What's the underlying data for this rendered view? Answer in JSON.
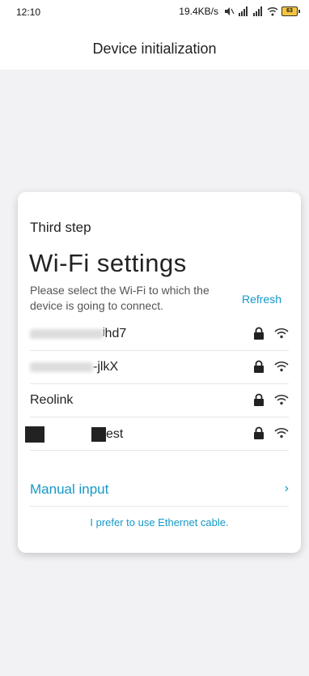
{
  "status_bar": {
    "time": "12:10",
    "speed": "19.4KB/s",
    "battery": "63"
  },
  "header": {
    "title": "Device initialization"
  },
  "card": {
    "step": "Third step",
    "heading": "Wi-Fi settings",
    "description": "Please select the Wi-Fi to which the device is going to connect.",
    "refresh_label": "Refresh",
    "networks": [
      {
        "name_visible": "ʲhd7"
      },
      {
        "name_visible": "-jlkX"
      },
      {
        "name_visible": "Reolink"
      },
      {
        "name_visible": "est"
      }
    ],
    "manual_label": "Manual input",
    "manual_chevron": "›",
    "ethernet_link": "I prefer to use Ethernet cable."
  },
  "colors": {
    "accent": "#1599c8"
  },
  "icons": {
    "lock": "lock-icon",
    "wifi": "wifi-icon",
    "chevron": "chevron-right-icon"
  }
}
